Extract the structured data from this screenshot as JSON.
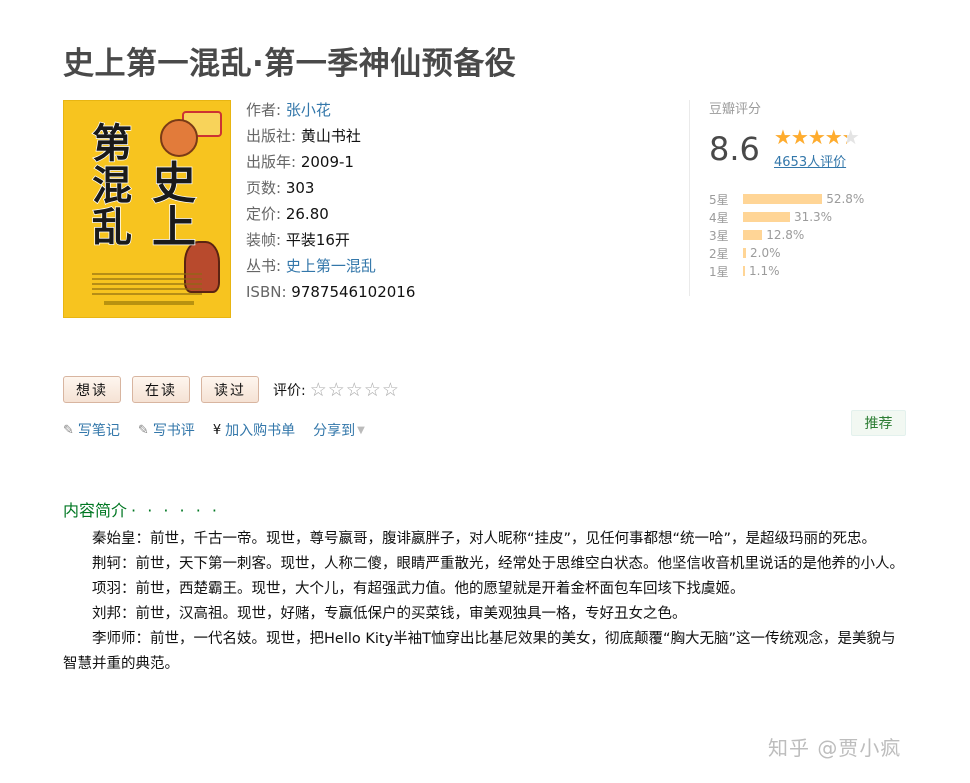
{
  "book": {
    "title": "史上第一混乱·第一季神仙预备役"
  },
  "details": {
    "author_label": "作者:",
    "author": "张小花",
    "publisher_label": "出版社:",
    "publisher": "黄山书社",
    "pubyear_label": "出版年:",
    "pubyear": "2009-1",
    "pages_label": "页数:",
    "pages": "303",
    "price_label": "定价:",
    "price": "26.80",
    "binding_label": "装帧:",
    "binding": "平装16开",
    "series_label": "丛书:",
    "series": "史上第一混乱",
    "isbn_label": "ISBN:",
    "isbn": "9787546102016"
  },
  "cover": {
    "chars": [
      "第",
      "一",
      "混",
      "乱",
      "史",
      "上"
    ]
  },
  "rating": {
    "label": "豆瓣评分",
    "score": "8.6",
    "stars": "★★★★★",
    "star_value": 4.3,
    "votes": "4653人评价",
    "accent": "#ffac2d",
    "distribution": [
      {
        "label": "5星",
        "pct": "52.8%",
        "value": 52.8
      },
      {
        "label": "4星",
        "pct": "31.3%",
        "value": 31.3
      },
      {
        "label": "3星",
        "pct": "12.8%",
        "value": 12.8
      },
      {
        "label": "2星",
        "pct": "2.0%",
        "value": 2.0
      },
      {
        "label": "1星",
        "pct": "1.1%",
        "value": 1.1
      }
    ]
  },
  "actions": {
    "want": "想读",
    "reading": "在读",
    "read": "读过",
    "rate_label": "评价:",
    "rate_stars": "☆☆☆☆☆"
  },
  "links": {
    "note": "写笔记",
    "review": "写书评",
    "cart_icon": "¥",
    "cart": "加入购书单",
    "share": "分享到"
  },
  "recommend": "推荐",
  "intro": {
    "title": "内容简介",
    "dots": "· · · · · ·",
    "paragraphs": [
      "秦始皇：前世，千古一帝。现世，尊号嬴哥，腹诽嬴胖子，对人昵称“挂皮”，见任何事都想“统一哈”，是超级玛丽的死忠。",
      "荆轲：前世，天下第一刺客。现世，人称二傻，眼睛严重散光，经常处于思维空白状态。他坚信收音机里说话的是他养的小人。",
      "项羽：前世，西楚霸王。现世，大个儿，有超强武力值。他的愿望就是开着金杯面包车回垓下找虞姬。",
      "刘邦：前世，汉高祖。现世，好赌，专赢低保户的买菜钱，审美观独具一格，专好丑女之色。",
      "李师师：前世，一代名妓。现世，把Hello Kity半袖T恤穿出比基尼效果的美女，彻底颠覆“胸大无脑”这一传统观念，是美貌与智慧并重的典范。"
    ]
  },
  "watermark": "知乎 @贾小疯"
}
